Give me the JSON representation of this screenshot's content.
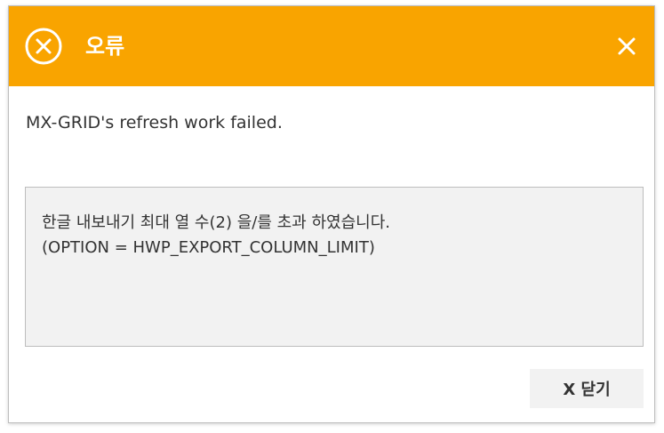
{
  "dialog": {
    "title": "오류",
    "header_color": "#f9a400",
    "title_icon": "error-circle-x-icon",
    "close_icon": "close-icon",
    "message": "MX-GRID's refresh work failed.",
    "detail_lines": [
      "한글 내보내기 최대 열 수(2) 을/를 초과 하였습니다.",
      "(OPTION = HWP_EXPORT_COLUMN_LIMIT)"
    ],
    "close_button_label": "X 닫기"
  }
}
